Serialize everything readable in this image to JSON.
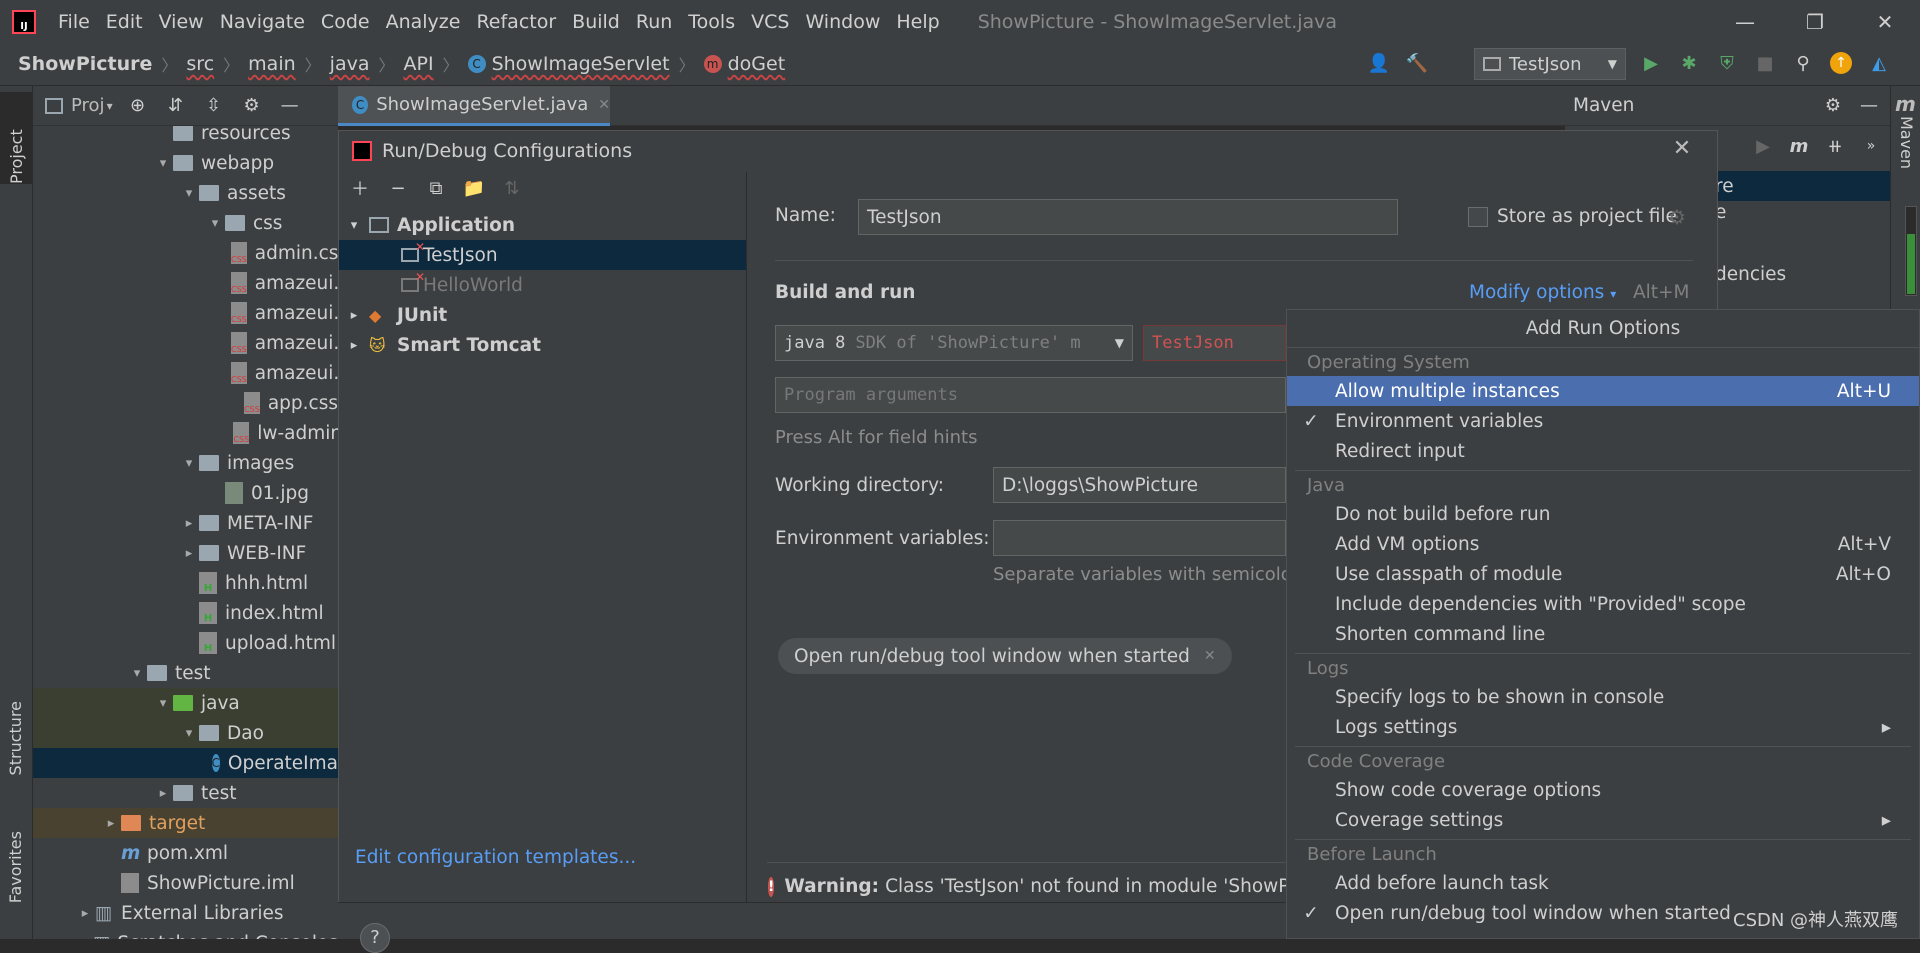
{
  "menubar": {
    "items": [
      "File",
      "Edit",
      "View",
      "Navigate",
      "Code",
      "Analyze",
      "Refactor",
      "Build",
      "Run",
      "Tools",
      "VCS",
      "Window",
      "Help"
    ],
    "title": "ShowPicture - ShowImageServlet.java"
  },
  "navbar": {
    "project": "ShowPicture",
    "crumbs": [
      "src",
      "main",
      "java",
      "API"
    ],
    "class": "ShowImageServlet",
    "method": "doGet",
    "run_config": "TestJson"
  },
  "left_strip": {
    "project": "Project",
    "structure": "Structure",
    "favorites": "Favorites"
  },
  "project_panel": {
    "title": "Proj",
    "tree": [
      {
        "label": "resources",
        "indent": 1,
        "kind": "folder",
        "arrow": ""
      },
      {
        "label": "webapp",
        "indent": 1,
        "kind": "folder",
        "arrow": "▾"
      },
      {
        "label": "assets",
        "indent": 2,
        "kind": "folder",
        "arrow": "▾"
      },
      {
        "label": "css",
        "indent": 3,
        "kind": "folder",
        "arrow": "▾"
      },
      {
        "label": "admin.cs",
        "indent": 4,
        "kind": "css",
        "arrow": ""
      },
      {
        "label": "amazeui.",
        "indent": 4,
        "kind": "css",
        "arrow": ""
      },
      {
        "label": "amazeui.",
        "indent": 4,
        "kind": "css",
        "arrow": ""
      },
      {
        "label": "amazeui.",
        "indent": 4,
        "kind": "css",
        "arrow": ""
      },
      {
        "label": "amazeui.",
        "indent": 4,
        "kind": "css",
        "arrow": ""
      },
      {
        "label": "app.css",
        "indent": 4,
        "kind": "css",
        "arrow": ""
      },
      {
        "label": "lw-admir",
        "indent": 4,
        "kind": "css",
        "arrow": ""
      },
      {
        "label": "images",
        "indent": 2,
        "kind": "folder",
        "arrow": "▾"
      },
      {
        "label": "01.jpg",
        "indent": 3,
        "kind": "img",
        "arrow": ""
      },
      {
        "label": "META-INF",
        "indent": 2,
        "kind": "folder",
        "arrow": "▸"
      },
      {
        "label": "WEB-INF",
        "indent": 2,
        "kind": "folder",
        "arrow": "▸"
      },
      {
        "label": "hhh.html",
        "indent": 2,
        "kind": "html",
        "arrow": ""
      },
      {
        "label": "index.html",
        "indent": 2,
        "kind": "html",
        "arrow": ""
      },
      {
        "label": "upload.html",
        "indent": 2,
        "kind": "html",
        "arrow": ""
      },
      {
        "label": "test",
        "indent": 0,
        "kind": "folder",
        "arrow": "▾"
      },
      {
        "label": "java",
        "indent": 1,
        "kind": "green",
        "arrow": "▾"
      },
      {
        "label": "Dao",
        "indent": 2,
        "kind": "folder",
        "arrow": "▾"
      },
      {
        "label": "OperateIma",
        "indent": 3,
        "kind": "class",
        "arrow": ""
      },
      {
        "label": "test",
        "indent": 1,
        "kind": "folder",
        "arrow": "▸"
      },
      {
        "label": "target",
        "indent": -1,
        "kind": "orange",
        "arrow": "▸"
      },
      {
        "label": "pom.xml",
        "indent": -1,
        "kind": "maven",
        "arrow": ""
      },
      {
        "label": "ShowPicture.iml",
        "indent": -1,
        "kind": "iml",
        "arrow": ""
      },
      {
        "label": "External Libraries",
        "indent": -2,
        "kind": "lib",
        "arrow": "▸"
      },
      {
        "label": "Scratches and Consoles",
        "indent": -2,
        "kind": "lib",
        "arrow": ""
      }
    ]
  },
  "editor": {
    "tab": "ShowImageServlet.java"
  },
  "maven": {
    "title": "Maven",
    "items": [
      "re",
      "e",
      "dencies"
    ],
    "strip": "Maven"
  },
  "dialog": {
    "title": "Run/Debug Configurations",
    "tree": {
      "application": "Application",
      "testjson": "TestJson",
      "helloworld": "HelloWorld",
      "junit": "JUnit",
      "smart_tomcat": "Smart Tomcat"
    },
    "edit_templates": "Edit configuration templates...",
    "name_label": "Name:",
    "name_value": "TestJson",
    "store_label": "Store as project file",
    "build_run": "Build and run",
    "modify_options": "Modify options",
    "modify_shortcut": "Alt+M",
    "sdk_main": "java 8",
    "sdk_sub": "SDK of 'ShowPicture' m",
    "main_class": "TestJson",
    "program_args_placeholder": "Program arguments",
    "hint": "Press Alt for field hints",
    "working_dir_label": "Working directory:",
    "working_dir_value": "D:\\loggs\\ShowPicture",
    "env_label": "Environment variables:",
    "env_hint": "Separate variables with semicolon",
    "chip": "Open run/debug tool window when started",
    "warning_bold": "Warning:",
    "warning_text": "Class 'TestJson' not found in module 'ShowPict"
  },
  "popup": {
    "title": "Add Run Options",
    "sections": [
      {
        "header": "Operating System",
        "items": [
          {
            "label": "Allow multiple instances",
            "shortcut": "Alt+U",
            "checked": false,
            "selected": true,
            "submenu": false
          },
          {
            "label": "Environment variables",
            "shortcut": "",
            "checked": true,
            "selected": false,
            "submenu": false
          },
          {
            "label": "Redirect input",
            "shortcut": "",
            "checked": false,
            "selected": false,
            "submenu": false
          }
        ]
      },
      {
        "header": "Java",
        "items": [
          {
            "label": "Do not build before run",
            "shortcut": "",
            "checked": false,
            "selected": false,
            "submenu": false
          },
          {
            "label": "Add VM options",
            "shortcut": "Alt+V",
            "checked": false,
            "selected": false,
            "submenu": false
          },
          {
            "label": "Use classpath of module",
            "shortcut": "Alt+O",
            "checked": false,
            "selected": false,
            "submenu": false
          },
          {
            "label": "Include dependencies with \"Provided\" scope",
            "shortcut": "",
            "checked": false,
            "selected": false,
            "submenu": false
          },
          {
            "label": "Shorten command line",
            "shortcut": "",
            "checked": false,
            "selected": false,
            "submenu": false
          }
        ]
      },
      {
        "header": "Logs",
        "items": [
          {
            "label": "Specify logs to be shown in console",
            "shortcut": "",
            "checked": false,
            "selected": false,
            "submenu": false
          },
          {
            "label": "Logs settings",
            "shortcut": "",
            "checked": false,
            "selected": false,
            "submenu": true
          }
        ]
      },
      {
        "header": "Code Coverage",
        "items": [
          {
            "label": "Show code coverage options",
            "shortcut": "",
            "checked": false,
            "selected": false,
            "submenu": false
          },
          {
            "label": "Coverage settings",
            "shortcut": "",
            "checked": false,
            "selected": false,
            "submenu": true
          }
        ]
      },
      {
        "header": "Before Launch",
        "items": [
          {
            "label": "Add before launch task",
            "shortcut": "",
            "checked": false,
            "selected": false,
            "submenu": false
          },
          {
            "label": "Open run/debug tool window when started",
            "shortcut": "",
            "checked": true,
            "selected": false,
            "submenu": false
          }
        ]
      }
    ]
  },
  "watermark": "CSDN @神人燕双鹰"
}
